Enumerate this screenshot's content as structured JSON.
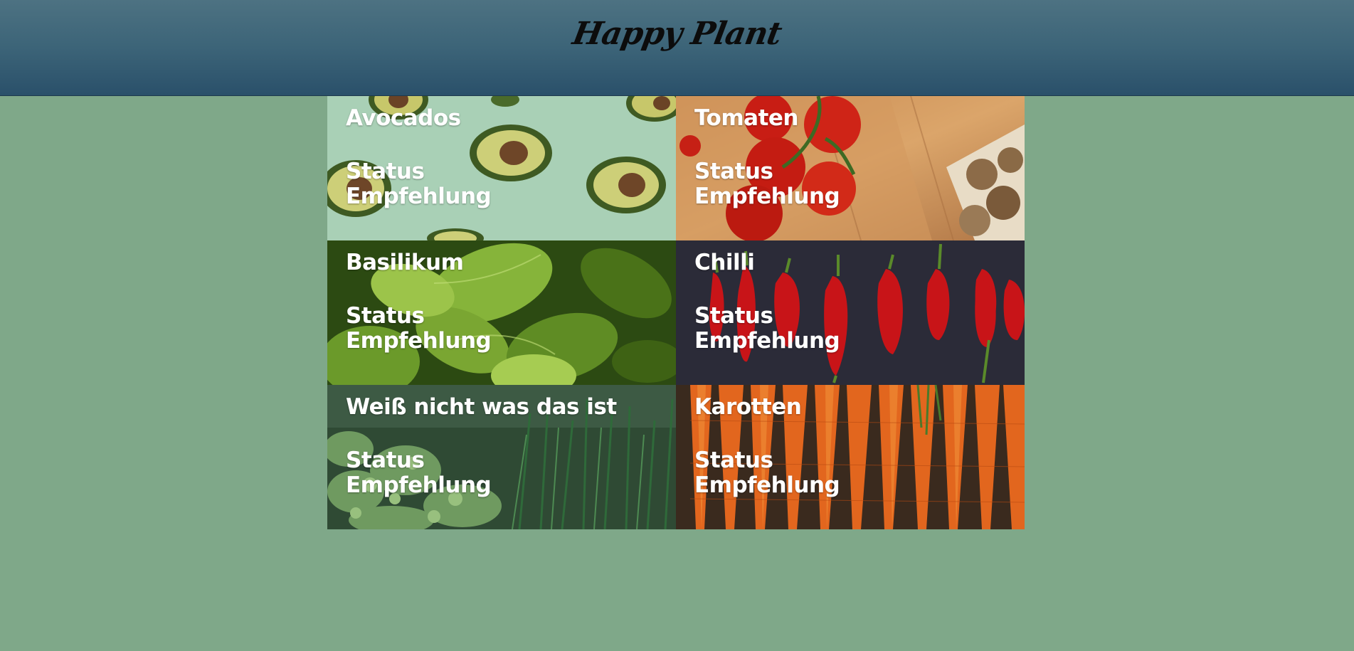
{
  "header": {
    "logo_text": "Happy Plant"
  },
  "tiles": [
    {
      "title": "Avocados",
      "status": "Status",
      "recommendation": "Empfehlung",
      "image": "avocado-image"
    },
    {
      "title": "Tomaten",
      "status": "Status",
      "recommendation": "Empfehlung",
      "image": "tomato-image"
    },
    {
      "title": "Basilikum",
      "status": "Status",
      "recommendation": "Empfehlung",
      "image": "basil-image"
    },
    {
      "title": "Chilli",
      "status": "Status",
      "recommendation": "Empfehlung",
      "image": "chilli-image"
    },
    {
      "title": "Weiß nicht was das ist",
      "status": "Status",
      "recommendation": "Empfehlung",
      "image": "herbs-image"
    },
    {
      "title": "Karotten",
      "status": "Status",
      "recommendation": "Empfehlung",
      "image": "carrot-image"
    }
  ]
}
